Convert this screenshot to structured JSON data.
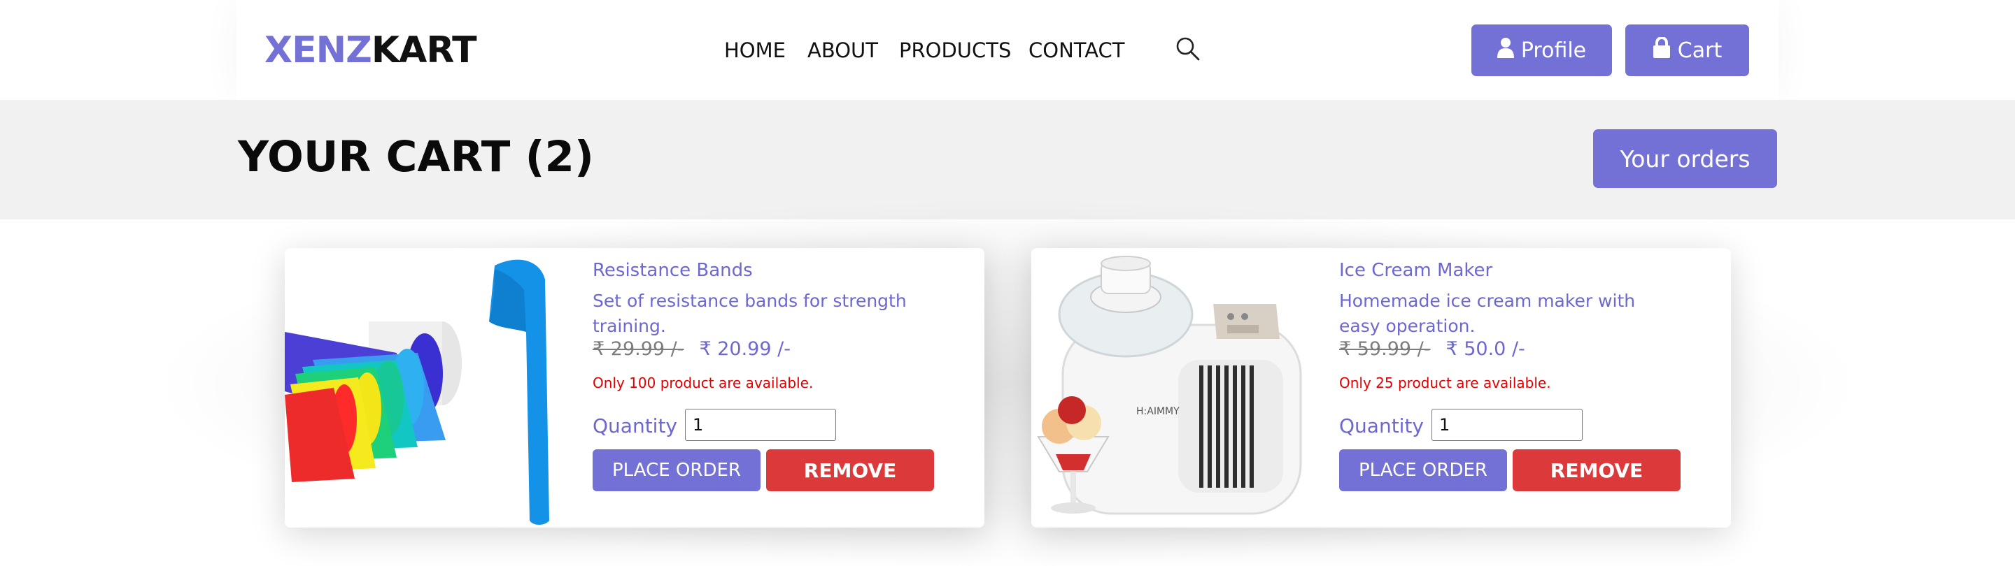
{
  "brand": {
    "part1": "XENZ",
    "part2": "KART"
  },
  "nav": {
    "items": [
      {
        "label": "HOME"
      },
      {
        "label": "ABOUT"
      },
      {
        "label": "PRODUCTS"
      },
      {
        "label": "CONTACT"
      }
    ],
    "search_icon": "search-icon"
  },
  "header_buttons": {
    "profile": {
      "label": "Profile",
      "icon": "user-icon"
    },
    "cart": {
      "label": "Cart",
      "icon": "lock-icon"
    }
  },
  "cart": {
    "title": "YOUR CART (2)",
    "orders_button": "Your orders"
  },
  "products": [
    {
      "name": "Resistance Bands",
      "description": "Set of resistance bands for strength training.",
      "old_price": "₹ 29.99 /-",
      "new_price": "₹ 20.99 /-",
      "availability": "Only 100 product are available.",
      "quantity_label": "Quantity :",
      "quantity": "1",
      "place_order": "PLACE ORDER",
      "remove": "REMOVE"
    },
    {
      "name": "Ice Cream Maker",
      "description": "Homemade ice cream maker with easy operation.",
      "old_price": "₹ 59.99 /-",
      "new_price": "₹ 50.0 /-",
      "availability": "Only 25 product are available.",
      "quantity_label": "Quantity :",
      "quantity": "1",
      "place_order": "PLACE ORDER",
      "remove": "REMOVE"
    }
  ],
  "colors": {
    "accent": "#7370d6",
    "danger": "#dc3a3a",
    "availability": "#e30000",
    "banner_bg": "#f1f1f1"
  }
}
